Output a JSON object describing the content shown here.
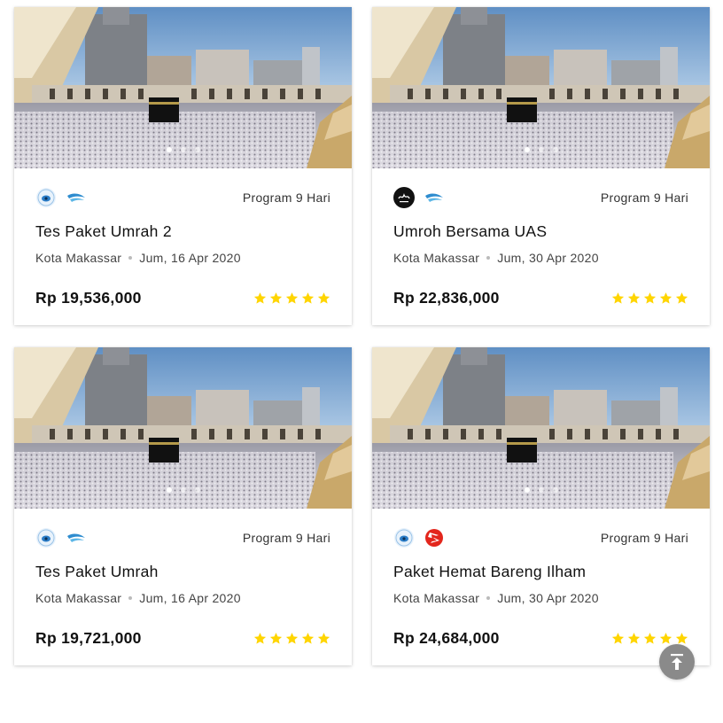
{
  "packages": [
    {
      "program": "Program 9 Hari",
      "title": "Tes Paket Umrah 2",
      "city": "Kota Makassar",
      "date": "Jum, 16 Apr 2020",
      "price": "Rp 19,536,000",
      "rating": 5,
      "logos": [
        "travel-agency-logo-icon",
        "garuda-airline-logo-icon"
      ]
    },
    {
      "program": "Program 9 Hari",
      "title": "Umroh Bersama UAS",
      "city": "Kota Makassar",
      "date": "Jum, 30 Apr 2020",
      "price": "Rp 22,836,000",
      "rating": 5,
      "logos": [
        "calligraphy-agency-logo-icon",
        "garuda-airline-logo-icon"
      ]
    },
    {
      "program": "Program 9 Hari",
      "title": "Tes Paket Umrah",
      "city": "Kota Makassar",
      "date": "Jum, 16 Apr 2020",
      "price": "Rp 19,721,000",
      "rating": 5,
      "logos": [
        "travel-agency-logo-icon",
        "garuda-airline-logo-icon"
      ]
    },
    {
      "program": "Program 9 Hari",
      "title": "Paket Hemat Bareng Ilham",
      "city": "Kota Makassar",
      "date": "Jum, 30 Apr 2020",
      "price": "Rp 24,684,000",
      "rating": 5,
      "logos": [
        "travel-agency-logo-icon",
        "lion-air-logo-icon"
      ]
    }
  ],
  "colors": {
    "star": "#FFD500",
    "scroll_button": "#8a8a8a"
  },
  "scroll_top_icon": "arrow-up-to-line-icon"
}
